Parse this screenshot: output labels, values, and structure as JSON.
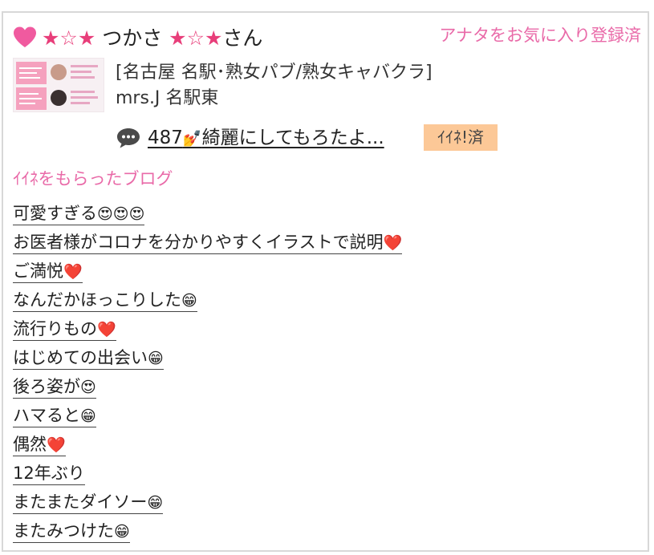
{
  "header": {
    "badge_icon": "heart-icon",
    "badge_color": "#f05a9f",
    "user_name_prefix_stars": "★☆★",
    "user_name": "つかさ",
    "user_name_suffix_stars": "★☆★",
    "honorific": "さん",
    "favorite_status": "アナタをお気に入り登録済"
  },
  "shop": {
    "thumbnail": "shop-banner-thumbnail",
    "category": "[名古屋 名駅･熟女パブ/熟女キャバクラ]",
    "name": "mrs.J 名駅東"
  },
  "comment": {
    "icon": "speech-bubble-icon",
    "count": "487",
    "decoration": "💅",
    "text": "綺麗にしてもろたよ...",
    "badge": "ｲｲﾈ!済",
    "badge_color": "#fcc897"
  },
  "liked_blogs": {
    "title": "ｲｲﾈをもらったブログ",
    "title_color": "#e96aa8",
    "items": [
      {
        "title": "可愛すぎる",
        "emoji": "😍😍😍"
      },
      {
        "title": "お医者様がコロナを分かりやすくイラストで説明",
        "emoji": "❤️"
      },
      {
        "title": "ご満悦",
        "emoji": "❤️"
      },
      {
        "title": "なんだかほっこりした",
        "emoji": "😁"
      },
      {
        "title": "流行りもの",
        "emoji": "❤️"
      },
      {
        "title": "はじめての出会い",
        "emoji": "😁"
      },
      {
        "title": "後ろ姿が",
        "emoji": "😍"
      },
      {
        "title": "ハマると",
        "emoji": "😁"
      },
      {
        "title": "偶然",
        "emoji": "❤️"
      },
      {
        "title": "12年ぶり",
        "emoji": ""
      },
      {
        "title": "またまたダイソー",
        "emoji": "😁"
      },
      {
        "title": "またみつけた",
        "emoji": "😁"
      }
    ]
  }
}
